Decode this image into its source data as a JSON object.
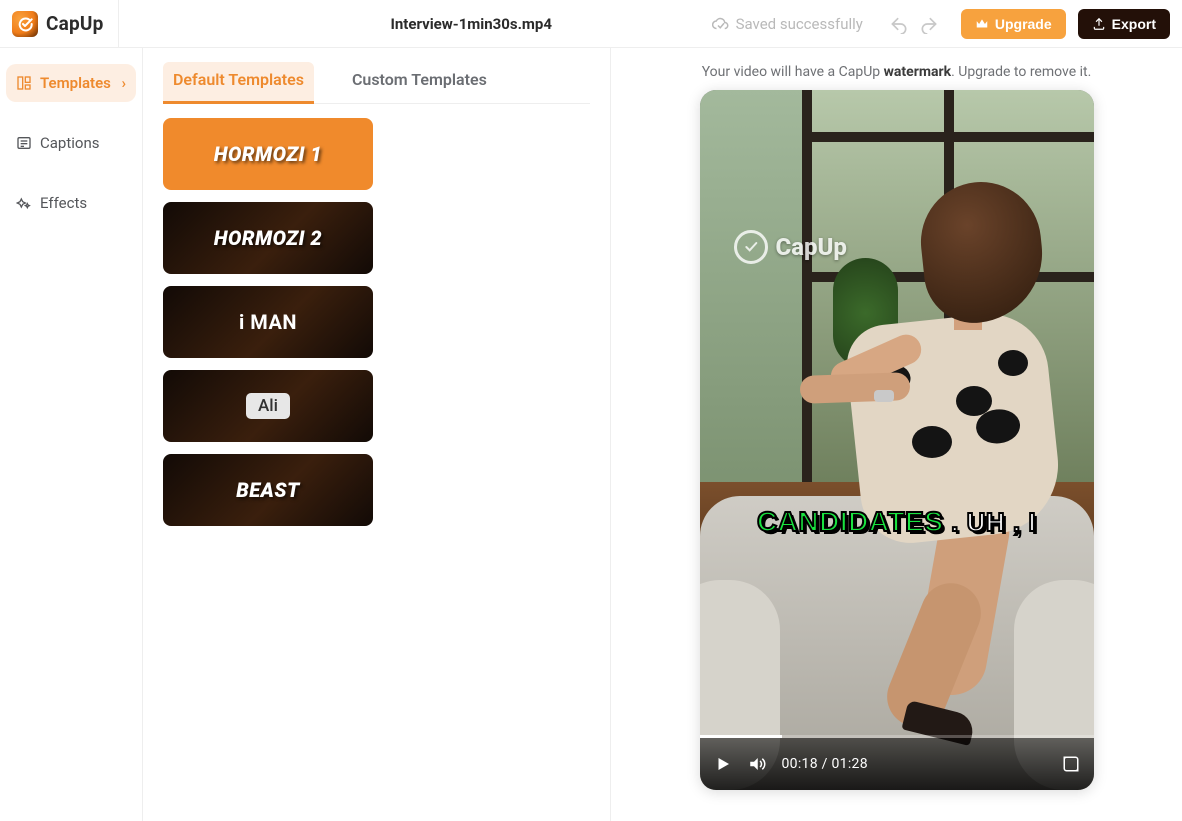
{
  "brand": {
    "name": "CapUp"
  },
  "header": {
    "filename": "Interview-1min30s.mp4",
    "saved_label": "Saved successfully",
    "upgrade_label": "Upgrade",
    "export_label": "Export"
  },
  "sidebar": {
    "items": [
      {
        "label": "Templates",
        "active": true
      },
      {
        "label": "Captions",
        "active": false
      },
      {
        "label": "Effects",
        "active": false
      }
    ]
  },
  "templates_panel": {
    "tabs": [
      {
        "label": "Default Templates",
        "active": true
      },
      {
        "label": "Custom Templates",
        "active": false
      }
    ],
    "templates": [
      {
        "name": "HORMOZI 1",
        "style": "orange",
        "selected": true
      },
      {
        "name": "HORMOZI 2",
        "style": "dark italic",
        "selected": false
      },
      {
        "name": "i MAN",
        "style": "dark plain",
        "selected": false
      },
      {
        "name": "Ali",
        "style": "dark chip",
        "selected": false
      },
      {
        "name": "BEAST",
        "style": "dark italic",
        "selected": false
      }
    ]
  },
  "preview": {
    "watermark_note_pre": "Your video will have a CapUp ",
    "watermark_note_bold": "watermark",
    "watermark_note_post": ". Upgrade to remove it.",
    "cu_watermark_text": "CapUp",
    "caption_highlight": "CANDIDATES",
    "caption_rest": " . UH , I",
    "player": {
      "current": "00:18",
      "sep": " / ",
      "duration": "01:28"
    }
  }
}
